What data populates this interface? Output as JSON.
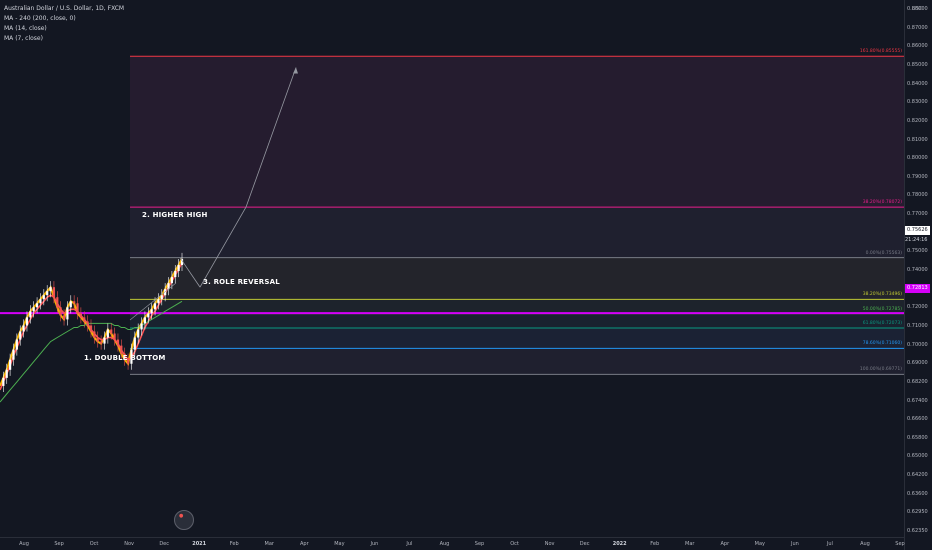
{
  "legend": {
    "symbol": "Australian Dollar / U.S. Dollar, 1D, FXCM",
    "indicators": [
      "MA - 240 (200, close, 0)",
      "MA (14, close)",
      "MA (7, close)"
    ]
  },
  "annotations": {
    "higher_high": "2. HIGHER HIGH",
    "role_reversal": "3. ROLE REVERSAL",
    "double_bottom": "1. DOUBLE BOTTOM"
  },
  "price_axis": {
    "currency": "USD",
    "ticks": [
      "0.88000",
      "0.87000",
      "0.86000",
      "0.85000",
      "0.84000",
      "0.83000",
      "0.82000",
      "0.81000",
      "0.80000",
      "0.79000",
      "0.78000",
      "0.77000",
      "0.76000",
      "0.75000",
      "0.74000",
      "0.73000",
      "0.72000",
      "0.71000",
      "0.70000",
      "0.69000",
      "0.68200",
      "0.67400",
      "0.66600",
      "0.65800",
      "0.65000",
      "0.64200",
      "0.63600",
      "0.62950",
      "0.62350"
    ],
    "last_price": "0.75626",
    "countdown": "21:24:16",
    "level_badge": "0.72813"
  },
  "time_axis": {
    "ticks": [
      {
        "label": "Aug",
        "bold": false
      },
      {
        "label": "Sep",
        "bold": false
      },
      {
        "label": "Oct",
        "bold": false
      },
      {
        "label": "Nov",
        "bold": false
      },
      {
        "label": "Dec",
        "bold": false
      },
      {
        "label": "2021",
        "bold": true
      },
      {
        "label": "Feb",
        "bold": false
      },
      {
        "label": "Mar",
        "bold": false
      },
      {
        "label": "Apr",
        "bold": false
      },
      {
        "label": "May",
        "bold": false
      },
      {
        "label": "Jun",
        "bold": false
      },
      {
        "label": "Jul",
        "bold": false
      },
      {
        "label": "Aug",
        "bold": false
      },
      {
        "label": "Sep",
        "bold": false
      },
      {
        "label": "Oct",
        "bold": false
      },
      {
        "label": "Nov",
        "bold": false
      },
      {
        "label": "Dec",
        "bold": false
      },
      {
        "label": "2022",
        "bold": true
      },
      {
        "label": "Feb",
        "bold": false
      },
      {
        "label": "Mar",
        "bold": false
      },
      {
        "label": "Apr",
        "bold": false
      },
      {
        "label": "May",
        "bold": false
      },
      {
        "label": "Jun",
        "bold": false
      },
      {
        "label": "Jul",
        "bold": false
      },
      {
        "label": "Aug",
        "bold": false
      },
      {
        "label": "Sep",
        "bold": false
      }
    ]
  },
  "chart_data": {
    "type": "line",
    "title": "Australian Dollar / U.S. Dollar, 1D, FXCM",
    "xlabel": "",
    "ylabel": "",
    "ylim": [
      0.6215,
      0.8815
    ],
    "grid": false,
    "fib_levels": [
      {
        "label": "161.80%(0.85555)",
        "value": 0.85555,
        "color": "#f23645"
      },
      {
        "label": "38.20%(0.78072)",
        "value": 0.78072,
        "color": "#e91e8c"
      },
      {
        "label": "0.00%(0.75563)",
        "value": 0.75563,
        "color": "#787b86"
      },
      {
        "label": "38.20%(0.73496)",
        "value": 0.73496,
        "color": "#c0ca33"
      },
      {
        "label": "50.00%(0.72785)",
        "value": 0.72785,
        "color": "#4caf50"
      },
      {
        "label": "61.80%(0.72073)",
        "value": 0.72073,
        "color": "#089981"
      },
      {
        "label": "78.60%(0.71060)",
        "value": 0.7106,
        "color": "#2196f3"
      },
      {
        "label": "100.00%(0.69771)",
        "value": 0.69771,
        "color": "#787b86"
      }
    ],
    "horizontal_level": {
      "value": 0.72813,
      "color": "#d500f9"
    },
    "series": [
      {
        "name": "Price",
        "color": "#f5b400",
        "values": [
          0.692,
          0.696,
          0.7,
          0.705,
          0.71,
          0.715,
          0.719,
          0.722,
          0.726,
          0.729,
          0.731,
          0.733,
          0.735,
          0.737,
          0.739,
          0.741,
          0.736,
          0.731,
          0.727,
          0.725,
          0.731,
          0.734,
          0.733,
          0.728,
          0.726,
          0.724,
          0.722,
          0.719,
          0.716,
          0.714,
          0.713,
          0.716,
          0.72,
          0.718,
          0.715,
          0.712,
          0.708,
          0.705,
          0.703,
          0.71,
          0.716,
          0.72,
          0.723,
          0.726,
          0.728,
          0.73,
          0.733,
          0.735,
          0.737,
          0.74,
          0.743,
          0.746,
          0.749,
          0.752,
          0.755
        ]
      },
      {
        "name": "MA (7, close)",
        "color": "#ff5252",
        "values": [
          0.69,
          0.694,
          0.698,
          0.702,
          0.707,
          0.711,
          0.715,
          0.719,
          0.722,
          0.725,
          0.728,
          0.73,
          0.732,
          0.734,
          0.736,
          0.737,
          0.736,
          0.733,
          0.73,
          0.728,
          0.729,
          0.73,
          0.73,
          0.729,
          0.727,
          0.725,
          0.723,
          0.72,
          0.718,
          0.716,
          0.715,
          0.715,
          0.716,
          0.716,
          0.715,
          0.713,
          0.71,
          0.707,
          0.705,
          0.706,
          0.709,
          0.713,
          0.717,
          0.721,
          0.724,
          0.727,
          0.729,
          0.732,
          0.735,
          0.738,
          0.741,
          0.744,
          0.747,
          0.75,
          0.753
        ]
      },
      {
        "name": "MA - 240 (200, close, 0)",
        "color": "#4caf50",
        "values": [
          0.684,
          0.686,
          0.688,
          0.69,
          0.692,
          0.694,
          0.696,
          0.698,
          0.7,
          0.702,
          0.704,
          0.706,
          0.708,
          0.71,
          0.712,
          0.714,
          0.715,
          0.716,
          0.717,
          0.718,
          0.719,
          0.72,
          0.721,
          0.721,
          0.722,
          0.722,
          0.723,
          0.723,
          0.723,
          0.723,
          0.723,
          0.723,
          0.723,
          0.723,
          0.722,
          0.722,
          0.721,
          0.721,
          0.72,
          0.72,
          0.721,
          0.721,
          0.722,
          0.723,
          0.724,
          0.725,
          0.726,
          0.727,
          0.728,
          0.729,
          0.73,
          0.731,
          0.732,
          0.733,
          0.734
        ]
      }
    ],
    "projection": [
      {
        "value": 0.75563
      },
      {
        "value": 0.741
      },
      {
        "value": 0.78072
      },
      {
        "value": 0.85
      }
    ]
  }
}
